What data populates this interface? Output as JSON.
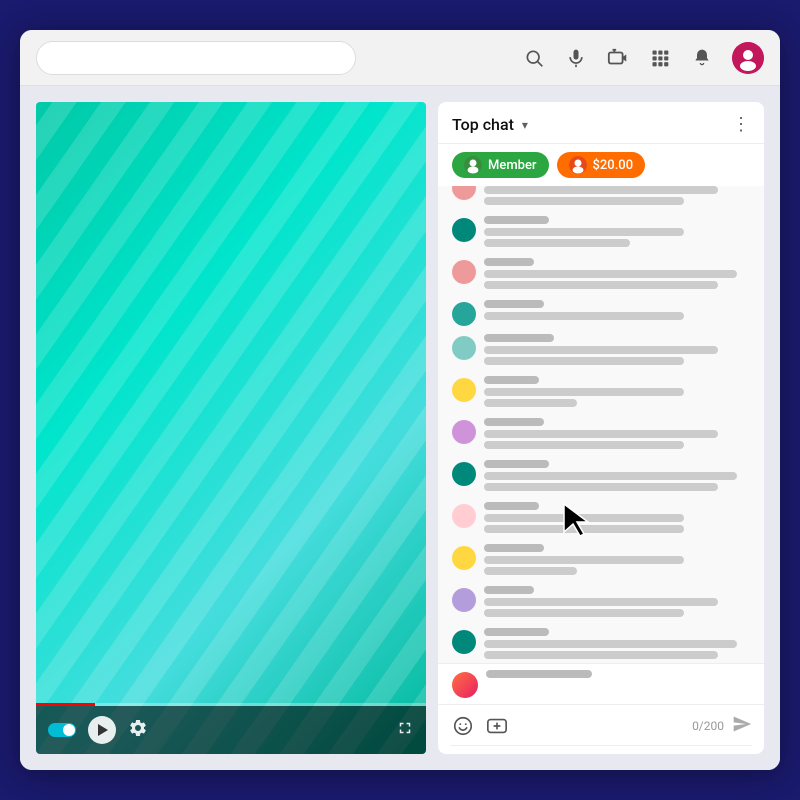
{
  "browser": {
    "search_placeholder": "",
    "icons": {
      "search": "🔍",
      "mic": "🎤",
      "create": "📹",
      "apps": "⊞",
      "notifications": "🔔"
    }
  },
  "video": {
    "is_playing": false,
    "progress_percent": 15
  },
  "chat": {
    "title": "Top chat",
    "dropdown_label": "▾",
    "more_label": "⋮",
    "filters": [
      {
        "type": "member",
        "label": "Member"
      },
      {
        "type": "donation",
        "label": "$20.00"
      }
    ],
    "messages": [
      {
        "id": 1,
        "avatar_color": "#ef9a9a",
        "name_width": 55,
        "lines": [
          {
            "w": "long"
          },
          {
            "w": "medium"
          }
        ]
      },
      {
        "id": 2,
        "avatar_color": "#00897b",
        "name_width": 65,
        "lines": [
          {
            "w": "medium"
          },
          {
            "w": "short"
          }
        ]
      },
      {
        "id": 3,
        "avatar_color": "#ef9a9a",
        "name_width": 50,
        "lines": [
          {
            "w": "full"
          },
          {
            "w": "long"
          }
        ]
      },
      {
        "id": 4,
        "avatar_color": "#26a69a",
        "name_width": 60,
        "lines": [
          {
            "w": "medium"
          }
        ]
      },
      {
        "id": 5,
        "avatar_color": "#80cbc4",
        "name_width": 70,
        "lines": [
          {
            "w": "long"
          },
          {
            "w": "medium"
          }
        ]
      },
      {
        "id": 6,
        "avatar_color": "#ffd740",
        "name_width": 55,
        "lines": [
          {
            "w": "medium"
          },
          {
            "w": "xshort"
          }
        ]
      },
      {
        "id": 7,
        "avatar_color": "#ce93d8",
        "name_width": 60,
        "lines": [
          {
            "w": "long"
          },
          {
            "w": "medium"
          }
        ]
      },
      {
        "id": 8,
        "avatar_color": "#00897b",
        "name_width": 65,
        "lines": [
          {
            "w": "full"
          },
          {
            "w": "long"
          }
        ]
      },
      {
        "id": 9,
        "avatar_color": "#ffcdd2",
        "name_width": 55,
        "lines": [
          {
            "w": "medium"
          },
          {
            "w": "medium"
          }
        ]
      },
      {
        "id": 10,
        "avatar_color": "#ffd740",
        "name_width": 60,
        "lines": [
          {
            "w": "medium"
          },
          {
            "w": "xshort"
          }
        ]
      },
      {
        "id": 11,
        "avatar_color": "#b39ddb",
        "name_width": 50,
        "lines": [
          {
            "w": "long"
          },
          {
            "w": "medium"
          }
        ]
      },
      {
        "id": 12,
        "avatar_color": "#00897b",
        "name_width": 65,
        "lines": [
          {
            "w": "full"
          },
          {
            "w": "long"
          }
        ]
      }
    ],
    "bottom_message": {
      "avatar_color": "linear-gradient(135deg, #ff7043, #e91e63)",
      "lines": [
        {
          "w": "xshort"
        }
      ]
    },
    "input": {
      "placeholder": "",
      "counter": "0/200"
    },
    "send_label": "➤",
    "emoji_icon": "😊",
    "super_chat_icon": "$"
  }
}
